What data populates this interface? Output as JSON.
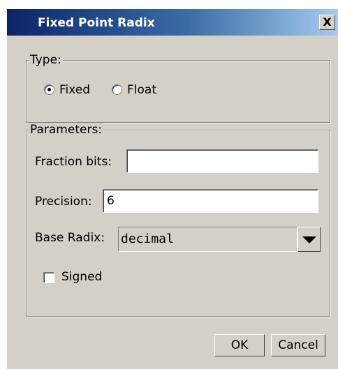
{
  "window": {
    "title": "Fixed Point Radix",
    "close_label": "X"
  },
  "type_group": {
    "legend": "Type:",
    "options": [
      {
        "label": "Fixed",
        "selected": true
      },
      {
        "label": "Float",
        "selected": false
      }
    ]
  },
  "parameters_group": {
    "legend": "Parameters:",
    "fraction_bits": {
      "label": "Fraction bits:",
      "value": ""
    },
    "precision": {
      "label": "Precision:",
      "value": "6"
    },
    "base_radix": {
      "label": "Base Radix:",
      "value": "decimal"
    },
    "signed": {
      "label": "Signed",
      "checked": false
    }
  },
  "buttons": {
    "ok": "OK",
    "cancel": "Cancel"
  },
  "colors": {
    "dialog_bg": "#d4d0c8",
    "title_start": "#0a246a",
    "title_end": "#a6caf0"
  },
  "icons": {
    "close": "close-icon",
    "dropdown": "chevron-down-icon"
  }
}
